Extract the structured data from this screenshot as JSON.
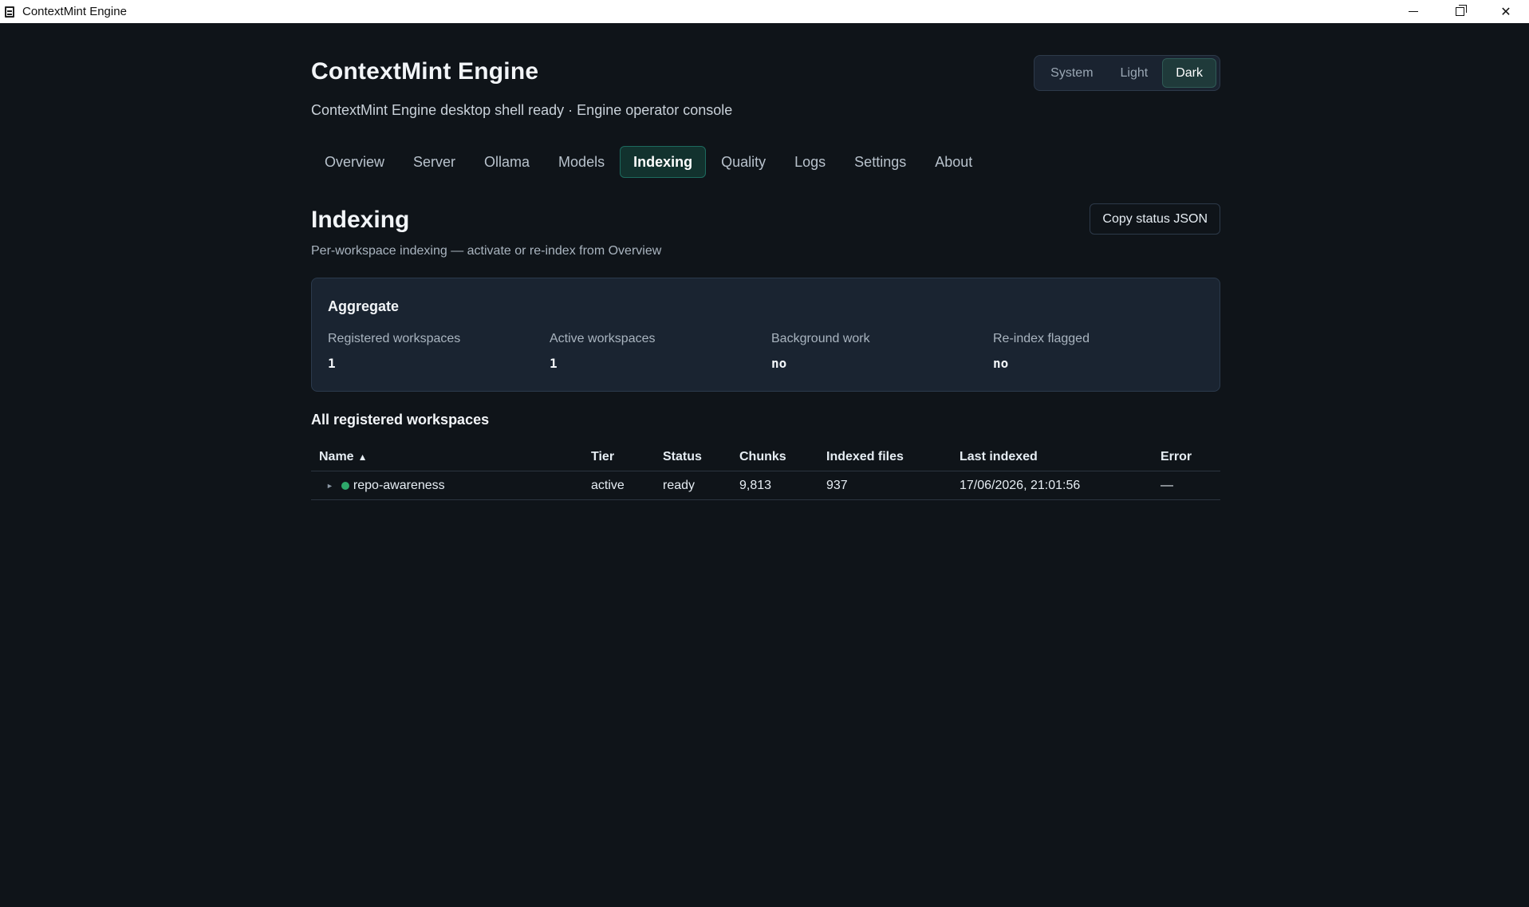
{
  "window": {
    "title": "ContextMint Engine"
  },
  "header": {
    "title": "ContextMint Engine",
    "subtitle": "ContextMint Engine desktop shell ready · Engine operator console"
  },
  "theme": {
    "options": [
      "System",
      "Light",
      "Dark"
    ],
    "selected": "Dark"
  },
  "tabs": [
    {
      "label": "Overview"
    },
    {
      "label": "Server"
    },
    {
      "label": "Ollama"
    },
    {
      "label": "Models"
    },
    {
      "label": "Indexing",
      "active": true
    },
    {
      "label": "Quality"
    },
    {
      "label": "Logs"
    },
    {
      "label": "Settings"
    },
    {
      "label": "About"
    }
  ],
  "section": {
    "title": "Indexing",
    "description": "Per-workspace indexing — activate or re-index from Overview",
    "copy_button": "Copy status JSON"
  },
  "aggregate": {
    "title": "Aggregate",
    "stats": [
      {
        "label": "Registered workspaces",
        "value": "1"
      },
      {
        "label": "Active workspaces",
        "value": "1"
      },
      {
        "label": "Background work",
        "value": "no"
      },
      {
        "label": "Re-index flagged",
        "value": "no"
      }
    ]
  },
  "workspaces": {
    "title": "All registered workspaces",
    "columns": [
      "Name",
      "Tier",
      "Status",
      "Chunks",
      "Indexed files",
      "Last indexed",
      "Error"
    ],
    "sort_indicator": "▲",
    "rows": [
      {
        "name": "repo-awareness",
        "tier": "active",
        "status": "ready",
        "chunks": "9,813",
        "indexed_files": "937",
        "last_indexed": "17/06/2026, 21:01:56",
        "error": "—",
        "status_color": "#2ea96b"
      }
    ]
  },
  "colors": {
    "accent": "#1d6a5e",
    "background": "#0f1419",
    "card": "#1a2431"
  }
}
